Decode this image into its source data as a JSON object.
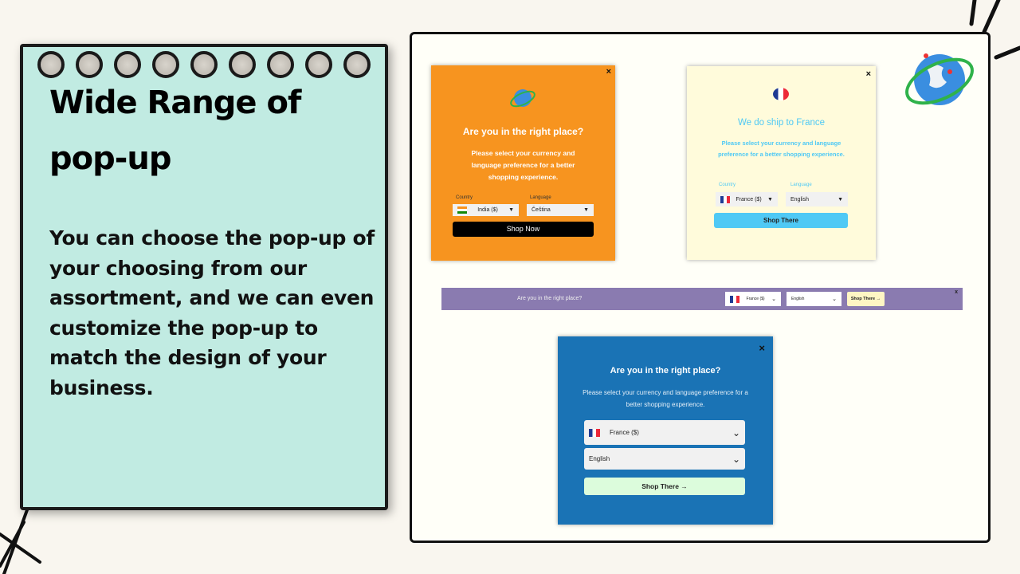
{
  "slide": {
    "title_line1": "Wide Range of",
    "title_line2": "pop-up",
    "body": "You can choose the pop-up of your choosing from our assortment, and we can even customize the pop-up to match the design of your business."
  },
  "colors": {
    "note": "#c1ebe2",
    "orange": "#f7941f",
    "cream": "#fffbdb",
    "purple": "#8a7bb0",
    "blue": "#1a73b5",
    "sky": "#4fc9f5"
  },
  "popup_orange": {
    "close": "×",
    "heading": "Are you in the right place?",
    "text": "Please select your currency and language preference for a better shopping experience.",
    "country_label": "Country",
    "country": "India ($)",
    "language_label": "Language",
    "language": "Čeština",
    "button": "Shop Now"
  },
  "popup_cream": {
    "close": "×",
    "heading": "We do ship to France",
    "text": "Please select your currency and language preference for a better shopping experience.",
    "country_label": "Country",
    "country": "France ($)",
    "language_label": "Language",
    "language": "English",
    "button": "Shop There"
  },
  "bar_purple": {
    "text": "Are you in the right place?",
    "country": "France ($)",
    "language": "English",
    "button": "Shop There →",
    "close": "x"
  },
  "popup_blue": {
    "close": "×",
    "heading": "Are you in the right place?",
    "text": "Please select your currency and language preference for a better shopping experience.",
    "country": "France ($)",
    "language": "English",
    "button": "Shop There →"
  }
}
